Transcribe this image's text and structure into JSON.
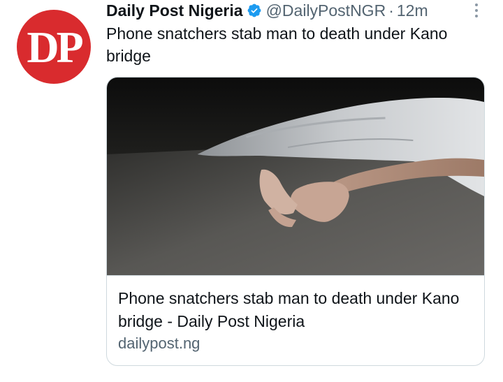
{
  "account": {
    "avatar_text": "DP",
    "display_name": "Daily Post Nigeria",
    "handle": "@DailyPostNGR",
    "separator": "·",
    "timestamp": "12m",
    "verified": true
  },
  "icons": {
    "verified": "verified-badge-icon",
    "more": "more-options-icon"
  },
  "tweet": {
    "text": "Phone snatchers stab man to death under Kano bridge"
  },
  "link_card": {
    "title": "Phone snatchers stab man to death under Kano bridge - Daily Post Nigeria",
    "domain": "dailypost.ng"
  },
  "colors": {
    "avatar_bg": "#d92b2e",
    "verified_blue": "#1d9bf0",
    "secondary_text": "#536471",
    "card_border": "#cfd9de"
  }
}
